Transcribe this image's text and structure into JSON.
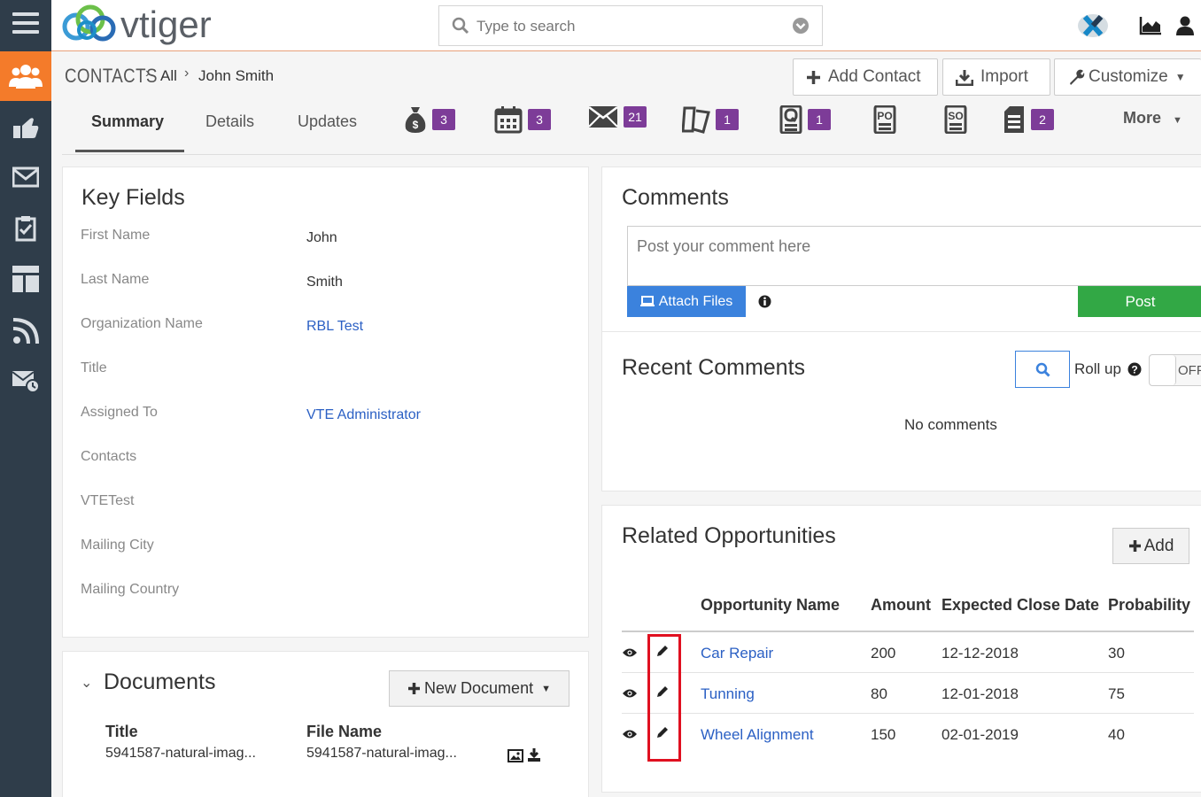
{
  "app": {
    "logo_text": "vtiger",
    "search_placeholder": "Type to search"
  },
  "sidebar": {
    "items": [
      {
        "icon": "contacts-icon",
        "active": true
      },
      {
        "icon": "marketing-icon"
      },
      {
        "icon": "inbox-icon"
      },
      {
        "icon": "tasks-icon"
      },
      {
        "icon": "dashboard-layout-icon"
      },
      {
        "icon": "rss-icon"
      },
      {
        "icon": "mail-schedule-icon"
      }
    ]
  },
  "header": {
    "module": "CONTACTS",
    "crumb_1": "All",
    "crumb_2": "John Smith",
    "add_contact": "Add Contact",
    "import": "Import",
    "customize": "Customize"
  },
  "tabs": {
    "summary": "Summary",
    "details": "Details",
    "updates": "Updates",
    "badges": [
      "3",
      "3",
      "21",
      "1",
      "1",
      "2"
    ],
    "icon_labels": [
      "PO",
      "SO"
    ],
    "more": "More"
  },
  "key_fields": {
    "title": "Key Fields",
    "fields": [
      {
        "label": "First Name",
        "value": "John"
      },
      {
        "label": "Last Name",
        "value": "Smith"
      },
      {
        "label": "Organization Name",
        "value": "RBL Test"
      },
      {
        "label": "Title",
        "value": ""
      },
      {
        "label": "Assigned To",
        "value": "VTE Administrator"
      },
      {
        "label": "Contacts",
        "value": ""
      },
      {
        "label": "VTETest",
        "value": ""
      },
      {
        "label": "Mailing City",
        "value": ""
      },
      {
        "label": "Mailing Country",
        "value": ""
      }
    ]
  },
  "documents": {
    "title": "Documents",
    "new_button": "New Document",
    "col_title": "Title",
    "col_file": "File Name",
    "row_title": "5941587-natural-imag...",
    "row_file": "5941587-natural-imag..."
  },
  "comments": {
    "title": "Comments",
    "placeholder": "Post your comment here",
    "attach": "Attach Files",
    "post": "Post"
  },
  "recent": {
    "title": "Recent Comments",
    "rollup": "Roll up",
    "toggle": "OFF",
    "empty": "No comments"
  },
  "opportunities": {
    "title": "Related Opportunities",
    "add": "Add",
    "headers": [
      "Opportunity Name",
      "Amount",
      "Expected Close Date",
      "Probability"
    ],
    "rows": [
      {
        "name": "Car Repair",
        "amount": "200",
        "date": "12-12-2018",
        "prob": "30"
      },
      {
        "name": "Tunning",
        "amount": "80",
        "date": "12-01-2018",
        "prob": "75"
      },
      {
        "name": "Wheel Alignment",
        "amount": "150",
        "date": "02-01-2019",
        "prob": "40"
      }
    ]
  },
  "colors": {
    "accent": "#f47b2a",
    "nav": "#2f3d4a",
    "badge": "#7d3c98",
    "link": "#2b60c4",
    "post": "#32a845",
    "attach": "#3b82dd",
    "highlight": "#e01020"
  }
}
